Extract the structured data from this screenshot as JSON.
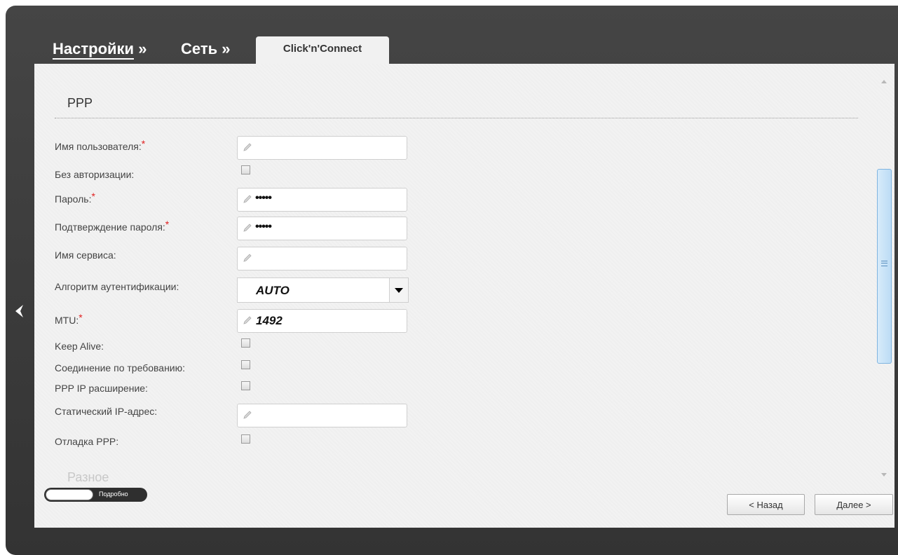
{
  "breadcrumb": {
    "item1": "Настройки",
    "sep1": "»",
    "item2": "Сеть",
    "sep2": "»",
    "active_tab": "Click'n'Connect"
  },
  "section": {
    "title": "PPP",
    "next_title": "Разное"
  },
  "required_mark": "*",
  "form": {
    "username": {
      "label": "Имя пользователя:",
      "value": ""
    },
    "no_auth": {
      "label": "Без авторизации:",
      "checked": false
    },
    "password": {
      "label": "Пароль:",
      "value": "•••••"
    },
    "password_confirm": {
      "label": "Подтверждение пароля:",
      "value": "•••••"
    },
    "service_name": {
      "label": "Имя сервиса:",
      "value": ""
    },
    "auth_algorithm": {
      "label": "Алгоритм аутентификации:",
      "value": "AUTO"
    },
    "mtu": {
      "label": "MTU:",
      "value": "1492"
    },
    "keep_alive": {
      "label": "Keep Alive:",
      "checked": false
    },
    "on_demand": {
      "label": "Соединение по требованию:",
      "checked": false
    },
    "ppp_ip_ext": {
      "label": "PPP IP расширение:",
      "checked": false
    },
    "static_ip": {
      "label": "Статический IP-адрес:",
      "value": ""
    },
    "ppp_debug": {
      "label": "Отладка PPP:",
      "checked": false
    }
  },
  "footer": {
    "toggle_label": "Подробно",
    "back_button": "< Назад",
    "next_button": "Далее >"
  },
  "icons": {
    "back_nav": "chevron-left-icon",
    "field_edit": "pencil-icon",
    "dropdown": "triangle-down-icon"
  },
  "colors": {
    "frame": "#3b3b3b",
    "panel": "#f2f2f2",
    "required": "#e02020",
    "scroll_thumb": "#c8e2f7"
  }
}
